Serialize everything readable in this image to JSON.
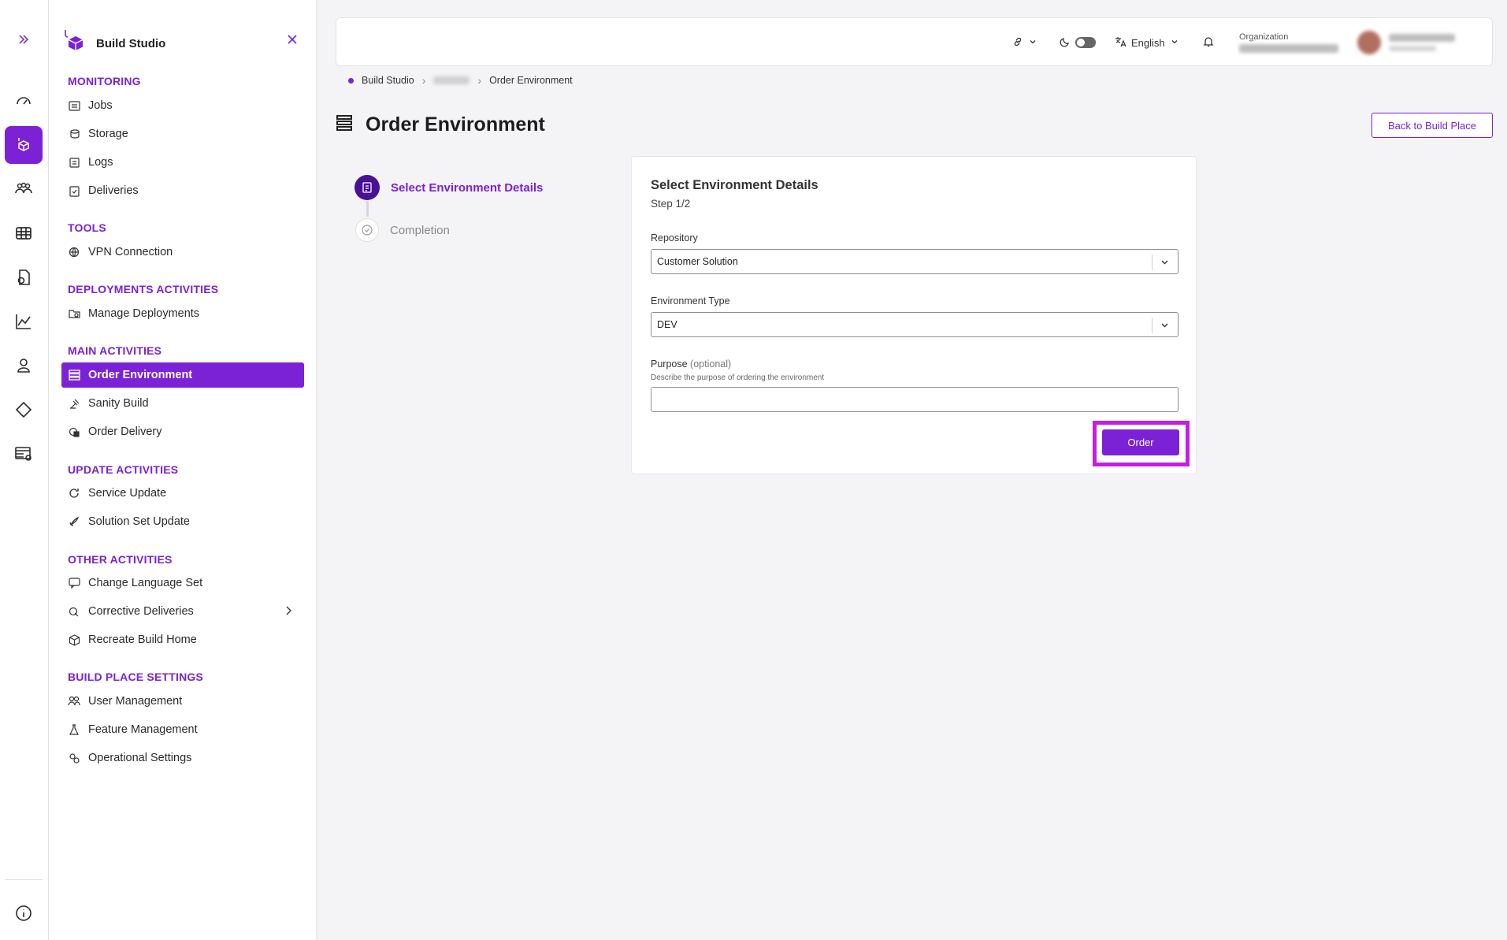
{
  "brand": {
    "title": "Build Studio"
  },
  "sidebar": {
    "sections": {
      "monitoring": "MONITORING",
      "tools": "TOOLS",
      "deployments": "DEPLOYMENTS ACTIVITIES",
      "main": "MAIN ACTIVITIES",
      "update": "UPDATE ACTIVITIES",
      "other": "OTHER ACTIVITIES",
      "settings": "BUILD PLACE SETTINGS"
    },
    "items": {
      "jobs": "Jobs",
      "storage": "Storage",
      "logs": "Logs",
      "deliveries": "Deliveries",
      "vpn": "VPN Connection",
      "manage_deployments": "Manage Deployments",
      "order_environment": "Order Environment",
      "sanity_build": "Sanity Build",
      "order_delivery": "Order Delivery",
      "service_update": "Service Update",
      "solution_set_update": "Solution Set Update",
      "change_language_set": "Change Language Set",
      "corrective_deliveries": "Corrective Deliveries",
      "recreate_build_home": "Recreate Build Home",
      "user_management": "User Management",
      "feature_management": "Feature Management",
      "operational_settings": "Operational Settings"
    },
    "active_item": "order_environment"
  },
  "header": {
    "language": "English",
    "org_label": "Organization"
  },
  "breadcrumb": {
    "root": "Build Studio",
    "current": "Order Environment"
  },
  "page": {
    "title": "Order Environment",
    "back_button": "Back to Build Place"
  },
  "stepper": {
    "steps": [
      {
        "label": "Select Environment Details",
        "state": "active"
      },
      {
        "label": "Completion",
        "state": "pending"
      }
    ]
  },
  "form": {
    "title": "Select Environment Details",
    "step_text": "Step 1/2",
    "repository_label": "Repository",
    "repository_value": "Customer Solution",
    "env_type_label": "Environment Type",
    "env_type_value": "DEV",
    "purpose_label": "Purpose",
    "purpose_optional": "(optional)",
    "purpose_help": "Describe the purpose of ordering the environment",
    "purpose_value": "",
    "order_button": "Order"
  },
  "colors": {
    "accent": "#7b22d6",
    "step_active": "#4a1196",
    "highlight": "#c51de8",
    "background": "#f4f3f6"
  }
}
